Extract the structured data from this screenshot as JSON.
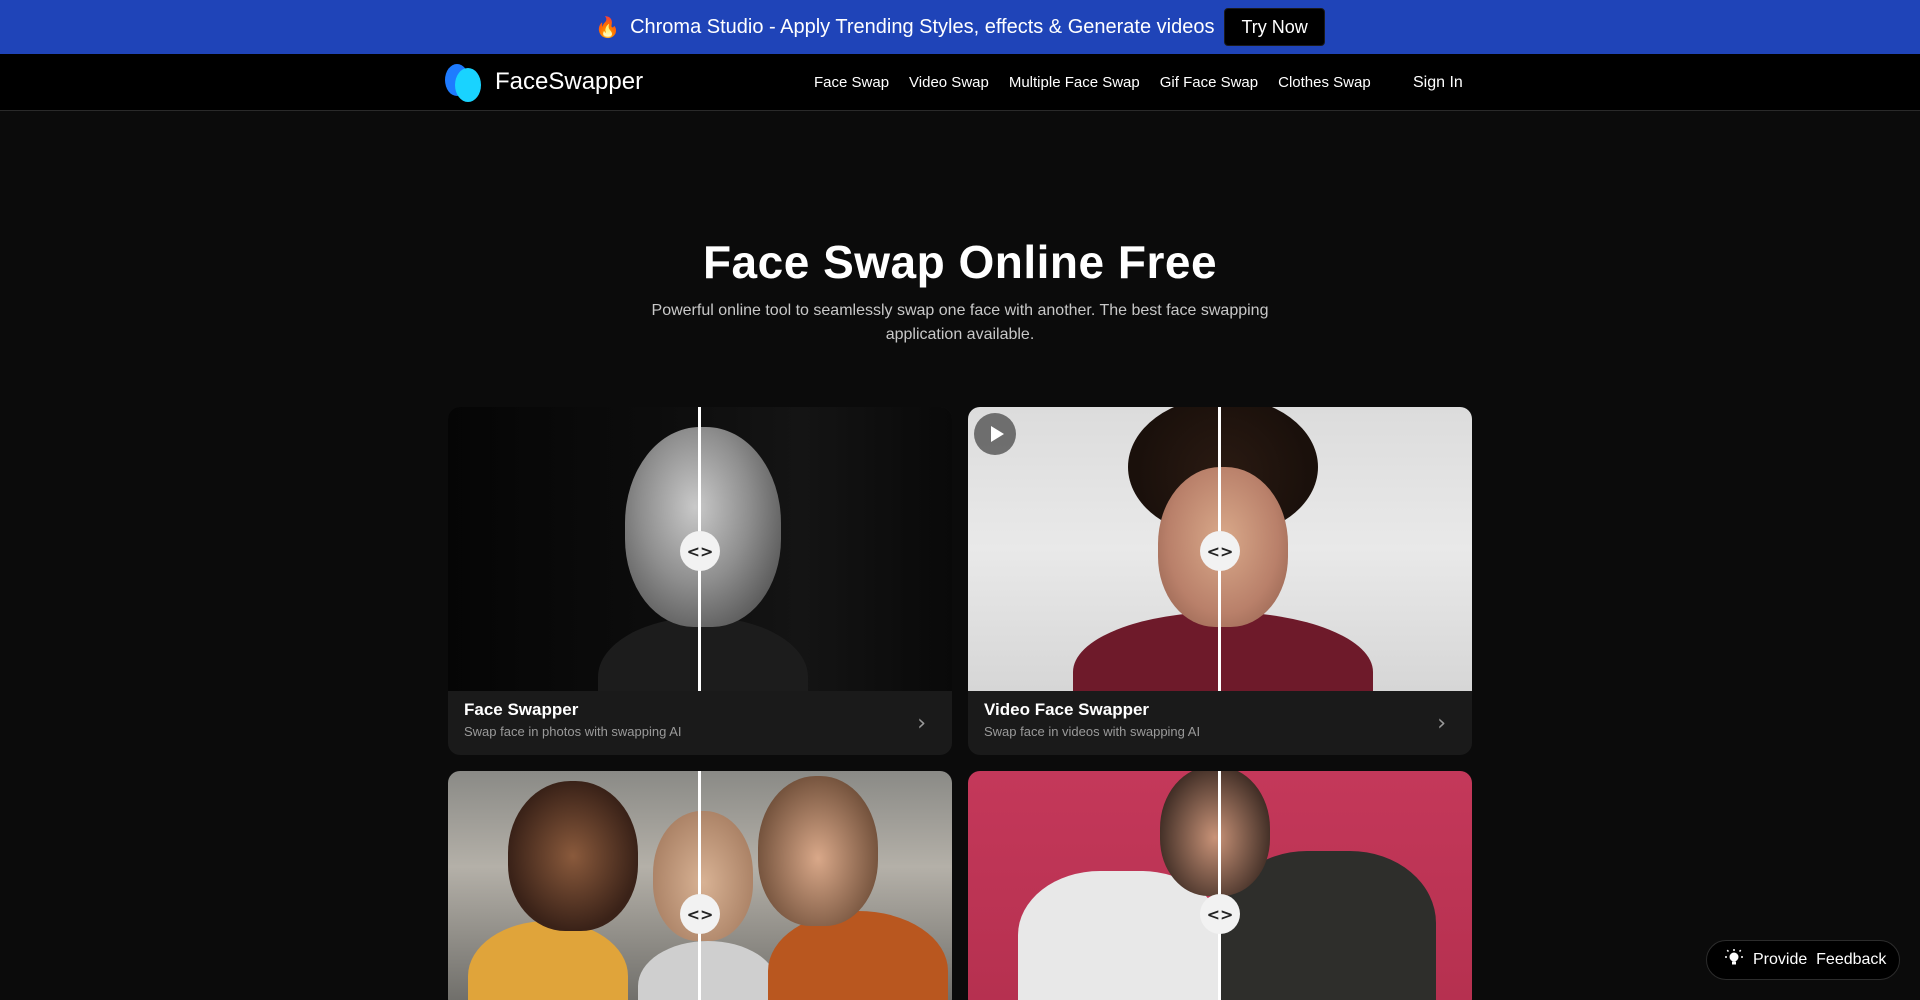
{
  "promo": {
    "icon": "fire-icon",
    "text": "Chroma Studio - Apply Trending Styles, effects & Generate videos",
    "button": "Try Now",
    "bg_color": "#1f44b8"
  },
  "nav": {
    "brand": "FaceSwapper",
    "links": [
      "Face Swap",
      "Video Swap",
      "Multiple Face Swap",
      "Gif Face Swap",
      "Clothes Swap"
    ],
    "signin": "Sign In"
  },
  "hero": {
    "title": "Face Swap Online Free",
    "subtitle": "Powerful online tool to seamlessly swap one face with another. The best face swapping application available."
  },
  "cards": [
    {
      "title": "Face Swapper",
      "desc": "Swap face in photos with swapping AI"
    },
    {
      "title": "Video Face Swapper",
      "desc": "Swap face in videos with swapping AI"
    }
  ],
  "compare_handle": "<>",
  "feedback": {
    "label": "Provide  Feedback",
    "icon": "lightbulb-icon"
  }
}
